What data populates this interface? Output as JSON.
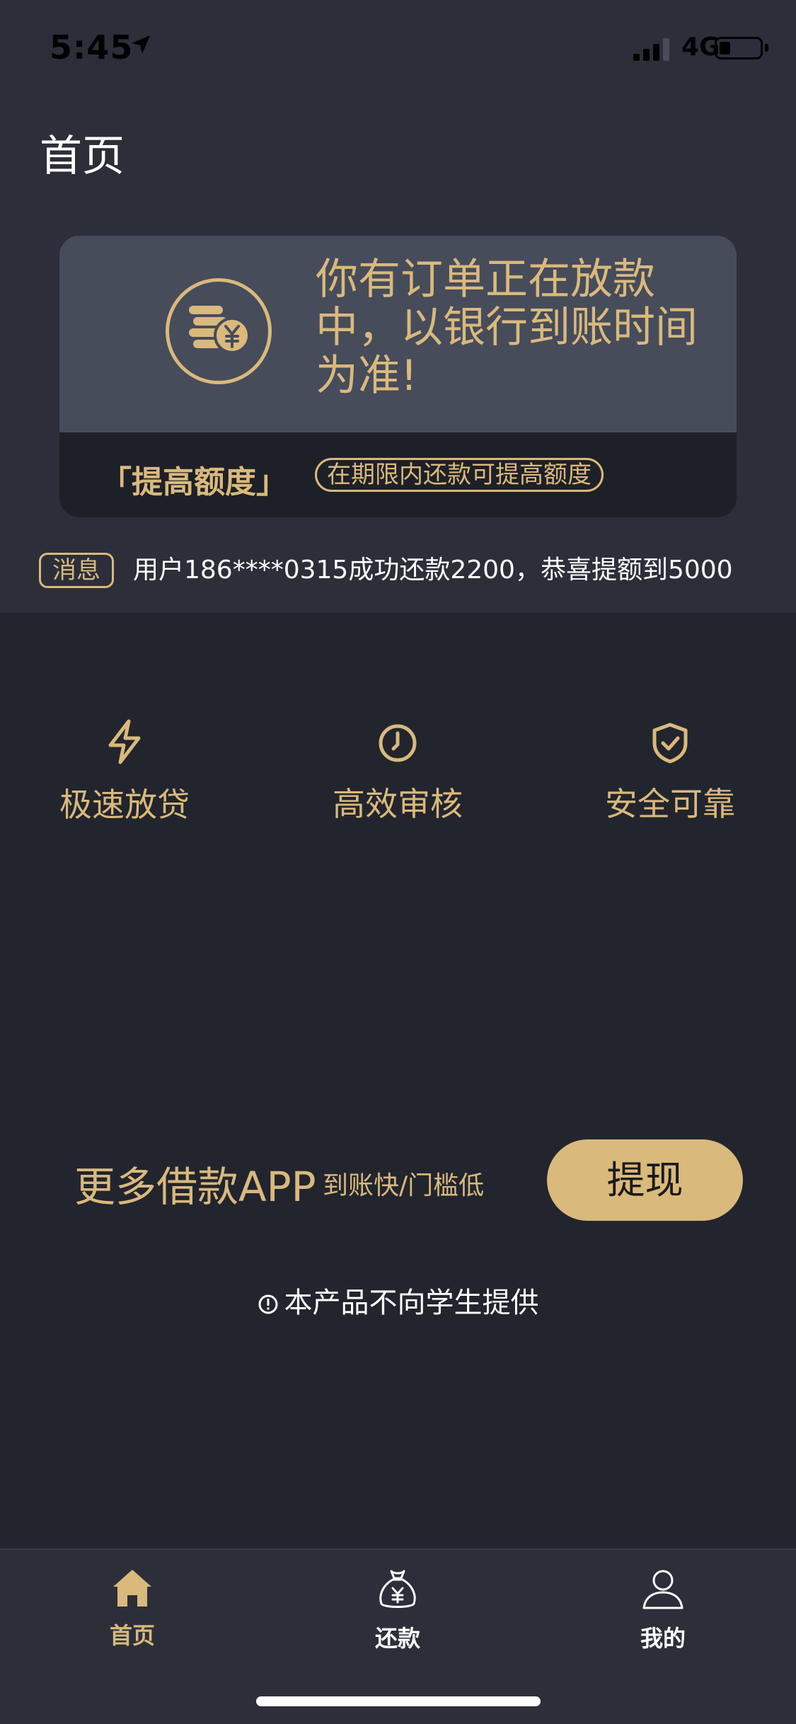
{
  "status_bar": {
    "time": "5:45",
    "network": "4G"
  },
  "header": {
    "title": "首页"
  },
  "notice_card": {
    "message": "你有订单正在放款中，以银行到账时间为准!",
    "raise_title": "「提高额度」",
    "raise_hint": "在期限内还款可提高额度"
  },
  "message_bar": {
    "tag": "消息",
    "text": "用户186****0315成功还款2200，恭喜提额到5000"
  },
  "features": [
    {
      "icon": "lightning-icon",
      "label": "极速放贷"
    },
    {
      "icon": "clock-icon",
      "label": "高效审核"
    },
    {
      "icon": "shield-check-icon",
      "label": "安全可靠"
    }
  ],
  "promo": {
    "title": "更多借款APP",
    "subtitle": "到账快/门槛低",
    "button": "提现"
  },
  "disclaimer": "本产品不向学生提供",
  "tabbar": {
    "items": [
      {
        "icon": "home-icon",
        "label": "首页",
        "active": true
      },
      {
        "icon": "money-bag-icon",
        "label": "还款",
        "active": false
      },
      {
        "icon": "user-icon",
        "label": "我的",
        "active": false
      }
    ]
  },
  "colors": {
    "accent": "#d9b97c",
    "background": "#22252e",
    "panel": "#2c2f3a",
    "card": "#474c5b"
  }
}
